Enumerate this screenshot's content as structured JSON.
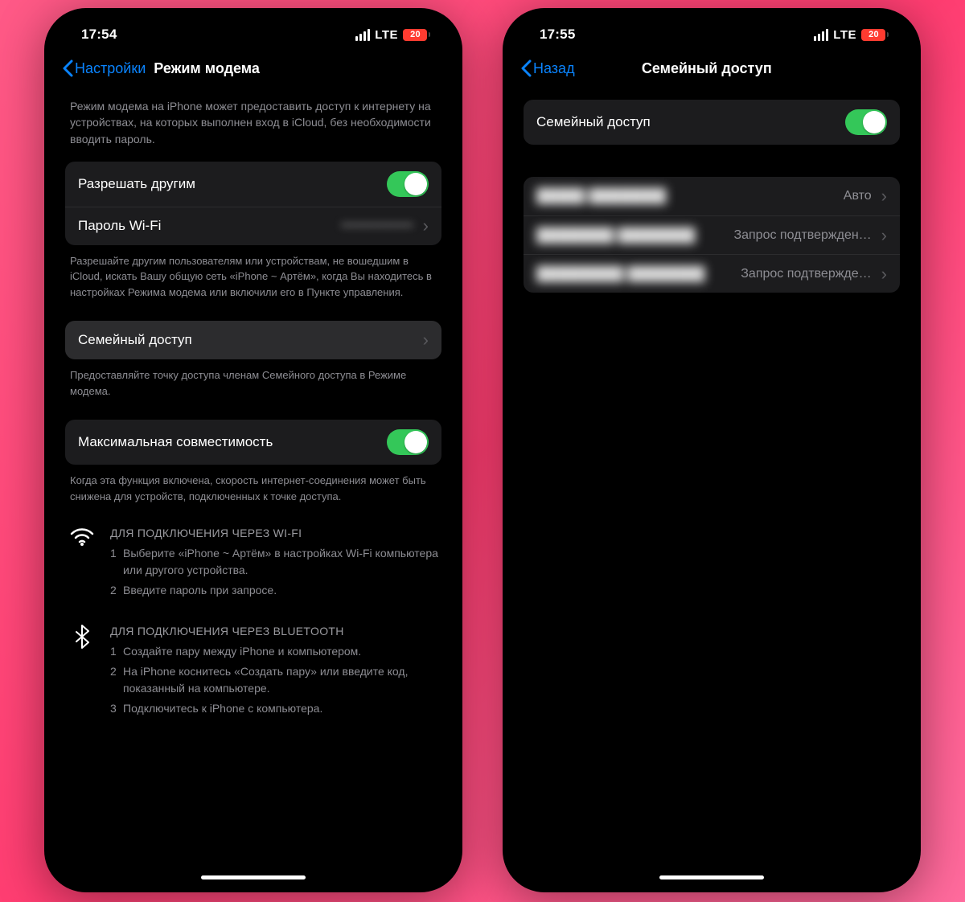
{
  "left": {
    "status": {
      "time": "17:54",
      "net": "LTE",
      "battery": "20"
    },
    "nav": {
      "back": "Настройки",
      "title": "Режим модема"
    },
    "intro": "Режим модема на iPhone может предоставить доступ к интернету на устройствах, на которых выполнен вход в iCloud, без необходимости вводить пароль.",
    "allow_others": "Разрешать другим",
    "wifi_password_label": "Пароль Wi-Fi",
    "wifi_password_value": "••••••••••••••••",
    "allow_footer": "Разрешайте другим пользователям или устройствам, не вошедшим в iCloud, искать Вашу общую сеть «iPhone ~ Артём», когда Вы находитесь в настройках Режима модема или включили его в Пункте управления.",
    "family_label": "Семейный доступ",
    "family_footer": "Предоставляйте точку доступа членам Семейного доступа в Режиме модема.",
    "compat_label": "Максимальная совместимость",
    "compat_footer": "Когда эта функция включена, скорость интернет-соединения может быть снижена для устройств, подключенных к точке доступа.",
    "wifi_instr": {
      "head": "ДЛЯ ПОДКЛЮЧЕНИЯ ЧЕРЕЗ WI-FI",
      "steps": [
        "Выберите «iPhone ~ Артём» в настройках Wi-Fi компьютера или другого устройства.",
        "Введите пароль при запросе."
      ]
    },
    "bt_instr": {
      "head": "ДЛЯ ПОДКЛЮЧЕНИЯ ЧЕРЕЗ BLUETOOTH",
      "steps": [
        "Создайте пару между iPhone и компьютером.",
        "На iPhone коснитесь «Создать пару» или введите код, показанный на компьютере.",
        "Подключитесь к iPhone с компьютера."
      ]
    }
  },
  "right": {
    "status": {
      "time": "17:55",
      "net": "LTE",
      "battery": "20"
    },
    "nav": {
      "back": "Назад",
      "title": "Семейный доступ"
    },
    "family_toggle_label": "Семейный доступ",
    "members": [
      {
        "name": "█████ ████████",
        "value": "Авто"
      },
      {
        "name": "████████ ████████",
        "value": "Запрос подтвержден…"
      },
      {
        "name": "█████████ ████████",
        "value": "Запрос подтвержде…"
      }
    ]
  }
}
